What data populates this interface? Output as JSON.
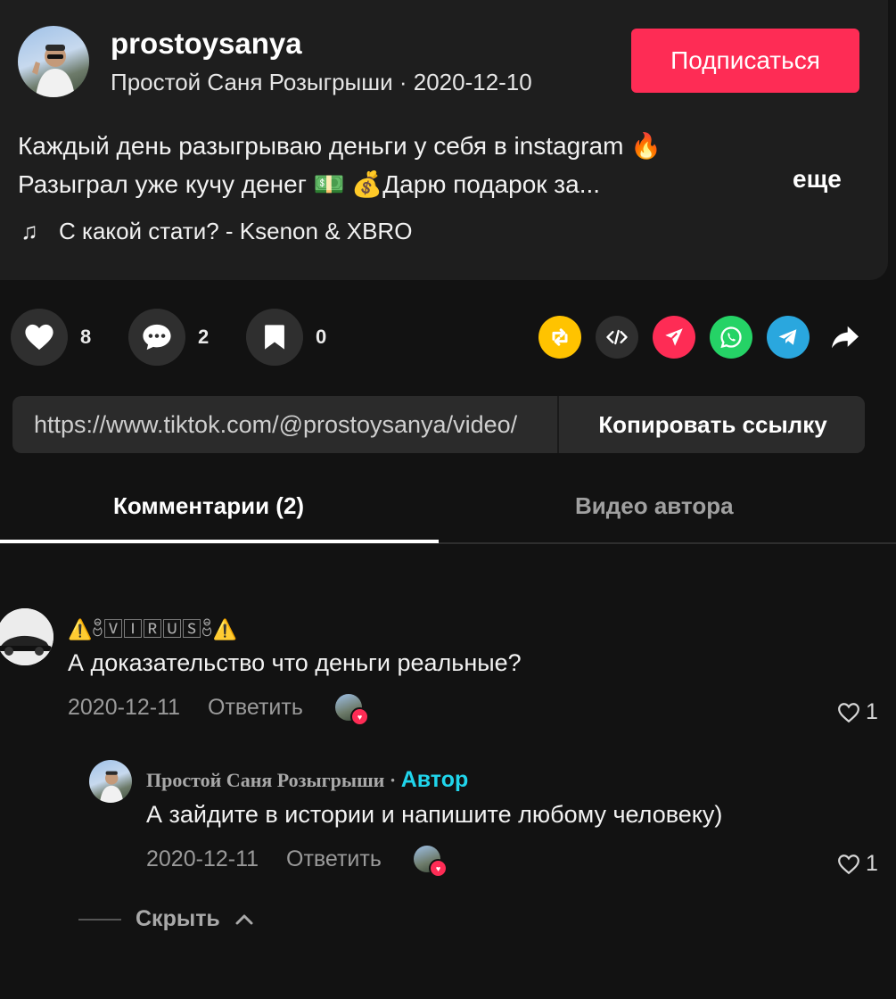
{
  "post": {
    "username": "prostoysanya",
    "display_name": "Простой Саня Розыгрыши",
    "date": "2020-12-10",
    "follow_label": "Подписаться",
    "desc_line1": "Каждый день разыгрываю деньги у себя в instagram 🔥",
    "desc_line2": "Разыграл уже кучу денег 💵   💰Дарю подарок за...",
    "more_label": "еще",
    "music": "С какой стати? - Ksenon & XBRO"
  },
  "actions": {
    "likes": "8",
    "comments": "2",
    "saves": "0",
    "icons": [
      "heart-icon",
      "comment-icon",
      "bookmark-icon"
    ]
  },
  "share": {
    "icons": [
      "repost-icon",
      "embed-icon",
      "send-icon",
      "whatsapp-icon",
      "telegram-icon",
      "share-arrow-icon"
    ],
    "colors": [
      "#ffc300",
      "#2f2f2f",
      "#fe2c55",
      "#25d366",
      "#2aa7de",
      "transparent"
    ]
  },
  "link": {
    "url": "https://www.tiktok.com/@prostoysanya/video/",
    "copy_label": "Копировать ссылку"
  },
  "tabs": {
    "comments": "Комментарии (2)",
    "author_videos": "Видео автора"
  },
  "comments": [
    {
      "name": "⚠️ဗီ🅅🄸🅁🅄🅂ဗီ⚠️",
      "text": "А доказательство что деньги реальные?",
      "date": "2020-12-11",
      "reply_label": "Ответить",
      "likes": "1"
    },
    {
      "name": "Простой Саня Розыгрыши",
      "author_badge": "Автор",
      "separator": "·",
      "text": "А зайдите в истории и напишите любому человеку)",
      "date": "2020-12-11",
      "reply_label": "Ответить",
      "likes": "1"
    }
  ],
  "hide_label": "Скрыть"
}
